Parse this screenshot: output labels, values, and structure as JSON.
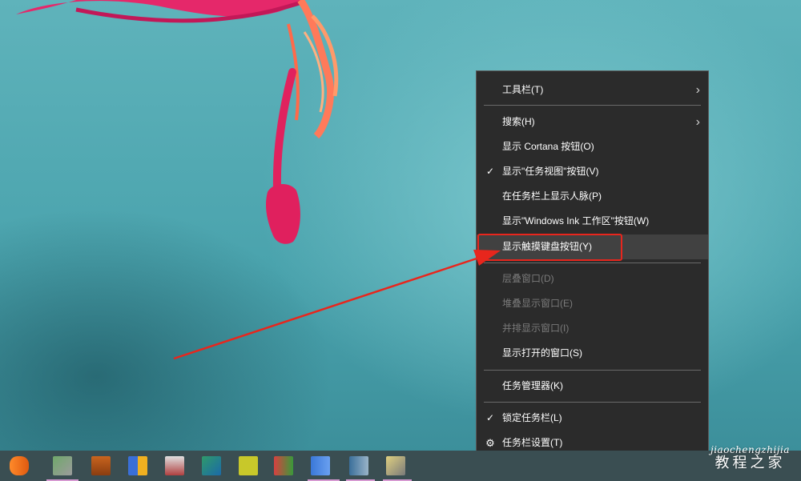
{
  "context_menu": {
    "items": [
      {
        "label": "工具栏(T)"
      },
      {
        "label": "搜索(H)"
      },
      {
        "label": "显示 Cortana 按钮(O)"
      },
      {
        "label": "显示\"任务视图\"按钮(V)"
      },
      {
        "label": "在任务栏上显示人脉(P)"
      },
      {
        "label": "显示\"Windows Ink 工作区\"按钮(W)"
      },
      {
        "label": "显示触摸键盘按钮(Y)"
      },
      {
        "label": "层叠窗口(D)"
      },
      {
        "label": "堆叠显示窗口(E)"
      },
      {
        "label": "并排显示窗口(I)"
      },
      {
        "label": "显示打开的窗口(S)"
      },
      {
        "label": "任务管理器(K)"
      },
      {
        "label": "锁定任务栏(L)"
      },
      {
        "label": "任务栏设置(T)"
      }
    ],
    "submenu_arrow": "›",
    "checkmark": "✓",
    "gear": "⚙",
    "checked_items": [
      "显示\"任务视图\"按钮(V)",
      "锁定任务栏(L)"
    ],
    "disabled_items": [
      "层叠窗口(D)",
      "堆叠显示窗口(E)",
      "并排显示窗口(I)"
    ],
    "highlighted_item": "显示触摸键盘按钮(Y)"
  },
  "watermark": {
    "url_text": "jiaochengzhijia",
    "cn_text": "教程之家"
  },
  "colors": {
    "menu_bg": "#2b2b2b",
    "highlight_box": "#e8261d",
    "taskbar": "#3a4e52"
  }
}
